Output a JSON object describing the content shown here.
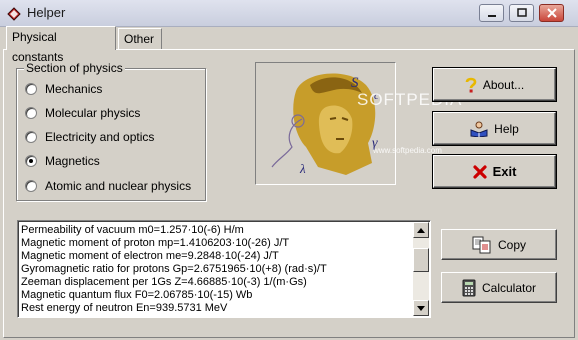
{
  "window": {
    "title": "Helper",
    "watermark": "SOFTPEDIA",
    "watermark_url": "www.softpedia.com"
  },
  "tabs": [
    {
      "label": "Physical constants",
      "active": true
    },
    {
      "label": "Other",
      "active": false
    }
  ],
  "section_group": {
    "legend": "Section of physics",
    "options": [
      {
        "label": "Mechanics",
        "selected": false
      },
      {
        "label": "Molecular physics",
        "selected": false
      },
      {
        "label": "Electricity and optics",
        "selected": false
      },
      {
        "label": "Magnetics",
        "selected": true
      },
      {
        "label": "Atomic and nuclear physics",
        "selected": false
      }
    ]
  },
  "buttons": {
    "about": "About...",
    "help": "Help",
    "exit": "Exit",
    "copy": "Copy",
    "calculator": "Calculator"
  },
  "constants_list": [
    "Permeability of vacuum  m0=1.257·10(-6) H/m",
    "Magnetic moment of proton  mp=1.4106203·10(-26) J/T",
    "Magnetic moment of electron  me=9.2848·10(-24) J/T",
    "Gyromagnetic ratio for protons Gp=2.6751965·10(+8) (rad·s)/T",
    "Zeeman displacement per 1Gs  Z=4.66885·10(-3) 1/(m·Gs)",
    "Magnetic quantum flux  F0=2.06785·10(-15) Wb",
    "Rest energy of neutron  En=939.5731 MeV"
  ],
  "icons": {
    "app": "helper-book-icon",
    "about": "question-mark-icon",
    "help": "help-book-icon",
    "exit": "red-x-icon",
    "copy": "copy-documents-icon",
    "calculator": "calculator-icon"
  },
  "colors": {
    "face": "#d4d0c8",
    "exit_x": "#cc0000",
    "about_q": "#e8b800",
    "list_bg": "#ffffff"
  }
}
